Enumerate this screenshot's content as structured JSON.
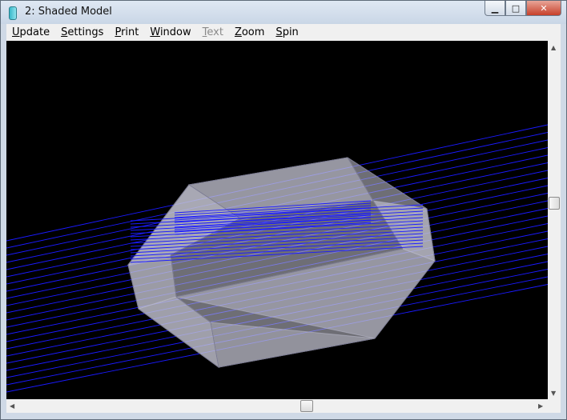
{
  "window": {
    "title": "2: Shaded Model"
  },
  "caption_buttons": {
    "minimize": "▁",
    "maximize": "□",
    "close": "✕"
  },
  "menu": [
    {
      "key": "update",
      "underlined": "U",
      "rest": "pdate",
      "enabled": true
    },
    {
      "key": "settings",
      "underlined": "S",
      "rest": "ettings",
      "enabled": true
    },
    {
      "key": "print",
      "underlined": "P",
      "rest": "rint",
      "enabled": true
    },
    {
      "key": "window",
      "underlined": "W",
      "rest": "indow",
      "enabled": true
    },
    {
      "key": "text",
      "underlined": "T",
      "rest": "ext",
      "enabled": false
    },
    {
      "key": "zoom",
      "underlined": "Z",
      "rest": "oom",
      "enabled": true
    },
    {
      "key": "spin",
      "underlined": "S",
      "rest": "pin",
      "enabled": true
    }
  ],
  "scrollbars": {
    "vertical_position": 0.45,
    "horizontal_position": 0.55,
    "up_arrow": "▲",
    "down_arrow": "▼",
    "left_arrow": "◀",
    "right_arrow": "▶"
  },
  "colors": {
    "background": "#000000",
    "wireframe": "#1a1aff",
    "solid_fill": "#c8c8d6"
  }
}
